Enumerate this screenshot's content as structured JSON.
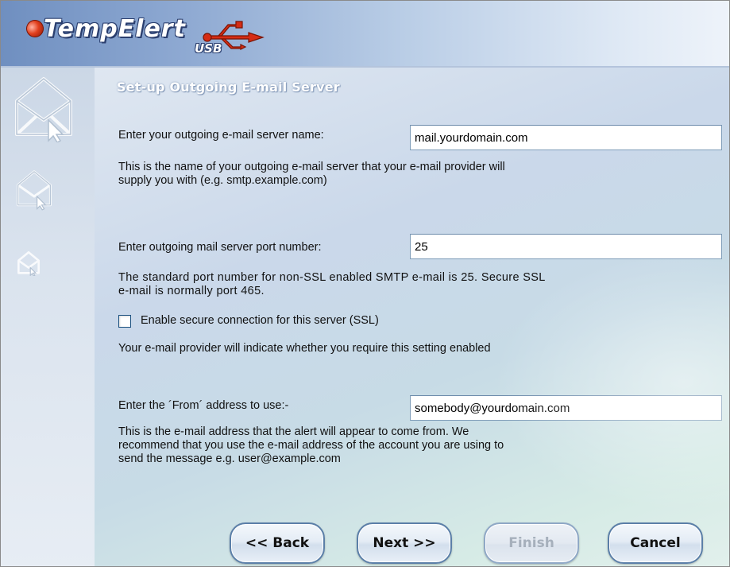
{
  "app": {
    "logo_text": "TempElert",
    "logo_sub": "USB"
  },
  "page": {
    "title": "Set-up Outgoing E-mail Server"
  },
  "server": {
    "label": "Enter your outgoing e-mail server name:",
    "value": "mail.yourdomain.com",
    "help_line1": "This is the name of your outgoing e-mail server that your e-mail provider will",
    "help_line2": "supply you with (e.g. smtp.example.com)"
  },
  "port": {
    "label": "Enter outgoing mail server port number:",
    "value": "25",
    "help_line1": "The standard port number for non-SSL enabled SMTP e-mail is 25. Secure SSL",
    "help_line2": "e-mail is normally port 465."
  },
  "ssl": {
    "label": "Enable secure connection for this server (SSL)",
    "checked": false,
    "help": "Your e-mail provider will indicate whether you require this setting enabled"
  },
  "from": {
    "label": "Enter the ´From´ address to use:-",
    "value": "somebody@yourdomain.com",
    "help_line1": "This is the e-mail address that the alert will appear to come from. We",
    "help_line2": "recommend that you use the e-mail address of the account you are using to",
    "help_line3": "send the message e.g. user@example.com"
  },
  "buttons": {
    "back": "<< Back",
    "next": "Next >>",
    "finish": "Finish",
    "cancel": "Cancel"
  },
  "colors": {
    "header_start": "#6f8fc0",
    "header_end": "#eef3fa",
    "button_border": "#5b7fa8",
    "field_border": "#7f9db9"
  },
  "icons": {
    "logo_mark": "usb-trident-icon",
    "sidebar": [
      "envelope-cursor-icon",
      "envelope-cursor-icon",
      "envelope-cursor-icon"
    ]
  }
}
